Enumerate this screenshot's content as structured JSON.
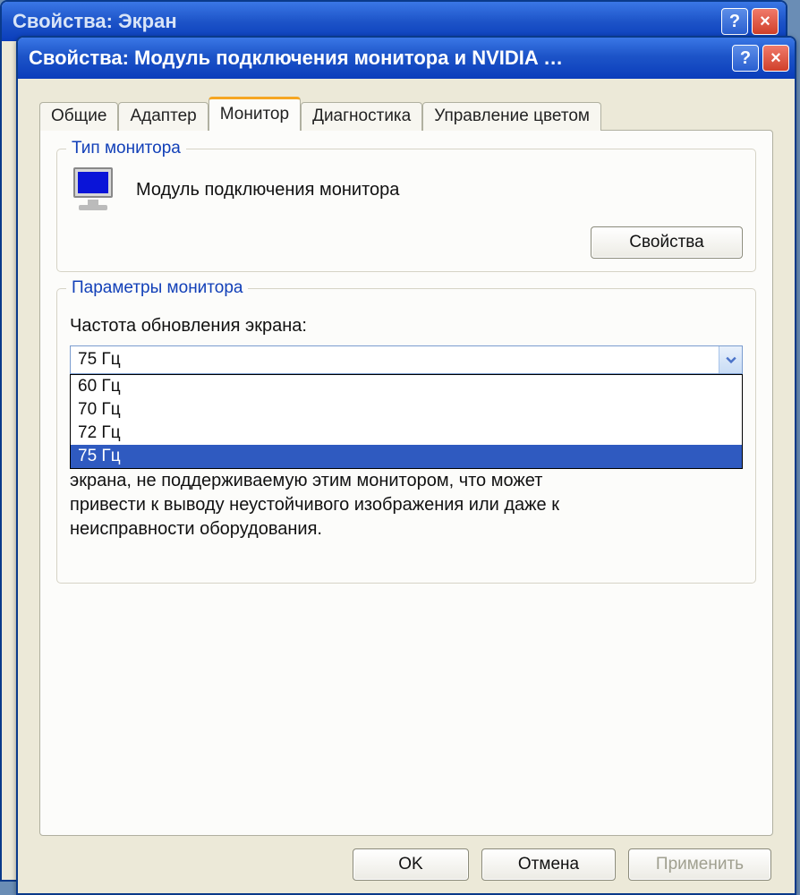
{
  "background_window": {
    "title": "Свойства: Экран"
  },
  "window": {
    "title": "Свойства: Модуль подключения монитора и NVIDIA …",
    "help_icon": "?",
    "close_icon": "×"
  },
  "tabs": {
    "items": [
      "Общие",
      "Адаптер",
      "Монитор",
      "Диагностика",
      "Управление цветом"
    ],
    "active_index": 2
  },
  "monitor_type_group": {
    "title": "Тип монитора",
    "device_label": "Модуль подключения монитора",
    "properties_button": "Свойства"
  },
  "monitor_params_group": {
    "title": "Параметры монитора",
    "freq_label": "Частота обновления экрана:",
    "selected_value": "75 Гц",
    "options": [
      "60 Гц",
      "70 Гц",
      "72 Гц",
      "75 Гц"
    ],
    "selected_index": 3,
    "hint_partial_top": "экрана, не поддерживаемую этим монитором, что может",
    "hint_line2": "привести к выводу неустойчивого изображения или даже к",
    "hint_line3": "неисправности оборудования."
  },
  "buttons": {
    "ok": "OK",
    "cancel": "Отмена",
    "apply": "Применить"
  }
}
